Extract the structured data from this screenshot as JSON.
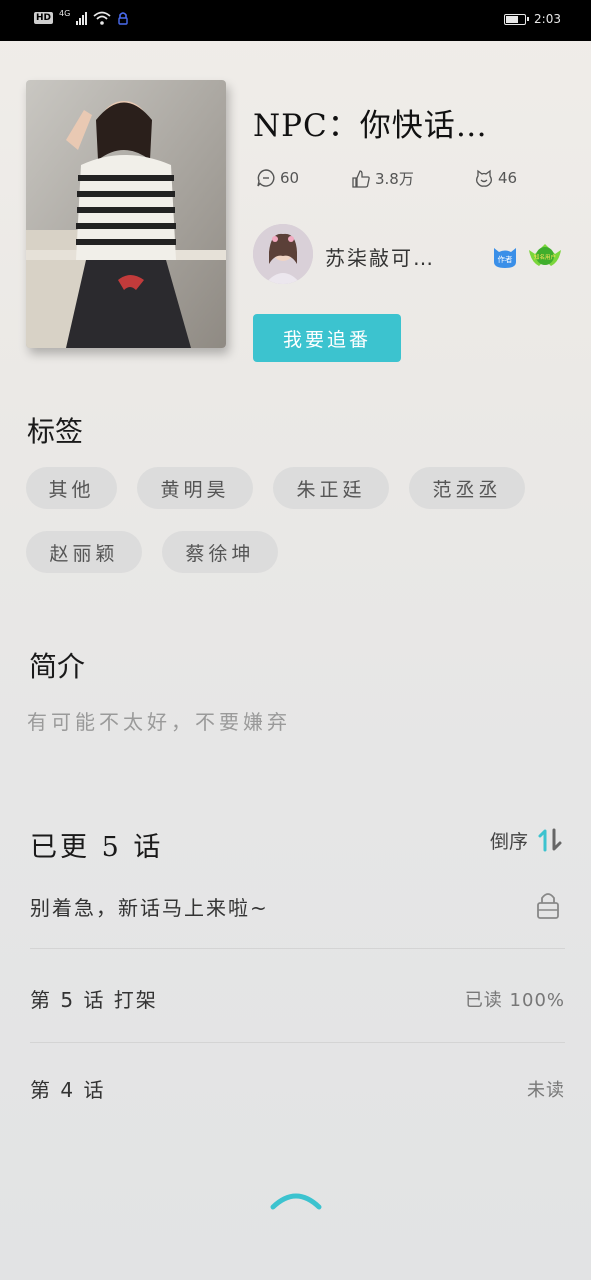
{
  "status_bar": {
    "left_label": "HD",
    "network": "4G",
    "time": "2:03",
    "battery_level": 0.7
  },
  "comic": {
    "title": "NPC：你快话…",
    "stats": {
      "comments": "60",
      "likes": "3.8万",
      "favorites": "46"
    }
  },
  "author": {
    "name": "苏柒敲可…",
    "author_badge": "作者",
    "level_badge": "知名用户"
  },
  "follow_button": "我要追番",
  "tags_section": {
    "title": "标签",
    "items": [
      "其他",
      "黄明昊",
      "朱正廷",
      "范丞丞",
      "赵丽颖",
      "蔡徐坤"
    ]
  },
  "intro_section": {
    "title": "简介",
    "text": "有可能不太好，不要嫌弃"
  },
  "episodes_section": {
    "header": "已更 5 话",
    "sort_label": "倒序",
    "locked_item": "别着急，新话马上来啦~",
    "items": [
      {
        "title": "第 5 话  打架",
        "status": "已读 100%"
      },
      {
        "title": "第 4 话",
        "status": "未读"
      }
    ]
  },
  "colors": {
    "accent": "#3cc3cf",
    "tag_bg": "#dcdcdc",
    "badge_blue": "#3a8fe8",
    "badge_green": "#57c93a"
  },
  "icons": [
    "comment-icon",
    "like-icon",
    "favorite-icon",
    "sort-icon",
    "lock-icon",
    "chevron-up-icon"
  ]
}
